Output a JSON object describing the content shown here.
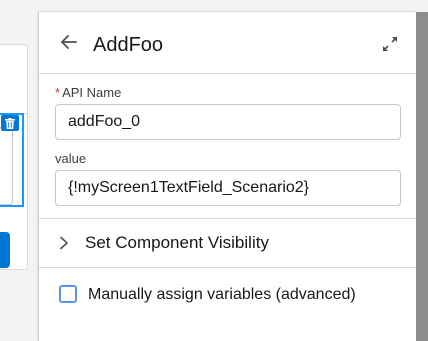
{
  "panel": {
    "title": "AddFoo",
    "back_icon": "arrow-left-icon",
    "expand_icon": "expand-icon"
  },
  "fields": {
    "api_name": {
      "required_marker": "*",
      "label": "API Name",
      "value": "addFoo_0"
    },
    "value": {
      "label": "value",
      "value": "{!myScreen1TextField_Scenario2}"
    }
  },
  "visibility_section": {
    "label": "Set Component Visibility",
    "icon": "chevron-right-icon"
  },
  "manual_assign": {
    "label": "Manually assign variables (advanced)",
    "checked": false
  },
  "canvas": {
    "trash_icon": "trash-icon"
  },
  "colors": {
    "accent": "#0176d3",
    "selection": "#1b96ff",
    "required": "#c23934",
    "checkbox_border": "#5a95e8",
    "scrollbar": "#8c8c8c"
  }
}
